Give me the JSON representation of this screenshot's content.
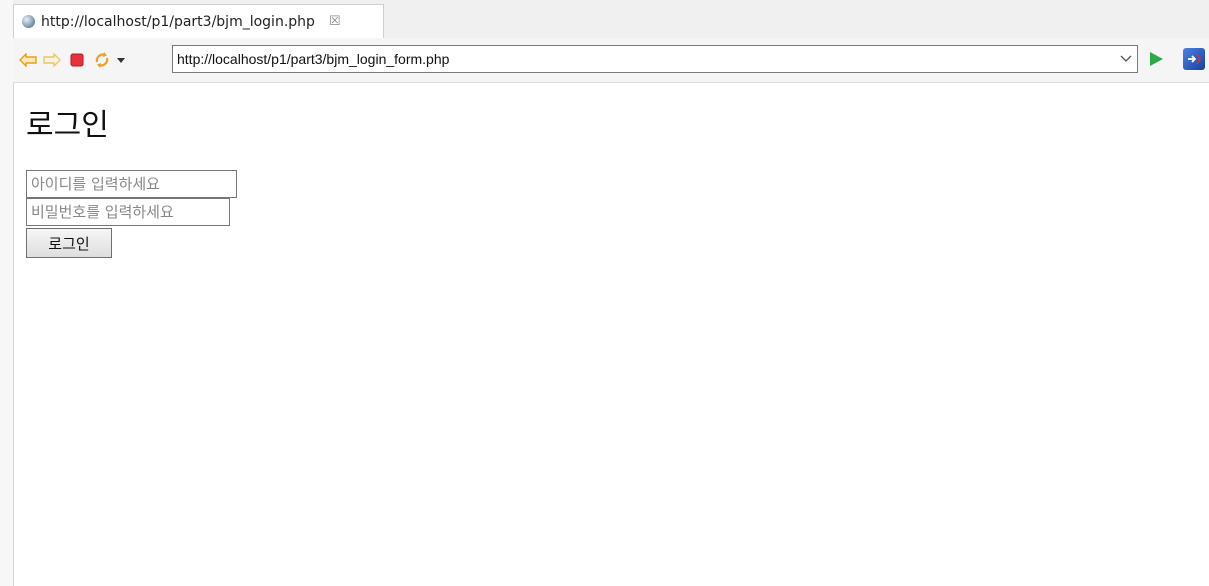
{
  "tab": {
    "title": "http://localhost/p1/part3/bjm_login.php",
    "close_icon": "close-icon"
  },
  "toolbar": {
    "back_icon": "back-arrow-icon",
    "forward_icon": "forward-arrow-icon",
    "stop_icon": "stop-icon",
    "refresh_icon": "refresh-icon",
    "url": "http://localhost/p1/part3/bjm_login_form.php",
    "go_icon": "play-go-icon",
    "sync_icon": "sync-icon",
    "colors": {
      "arrow": "#f0a020",
      "stop": "#e0303a",
      "go": "#2fa84a",
      "sync": "#2a5bd0"
    }
  },
  "page": {
    "title": "로그인",
    "id_placeholder": "아이디를 입력하세요",
    "pw_placeholder": "비밀번호를 입력하세요",
    "submit_label": "로그인"
  }
}
